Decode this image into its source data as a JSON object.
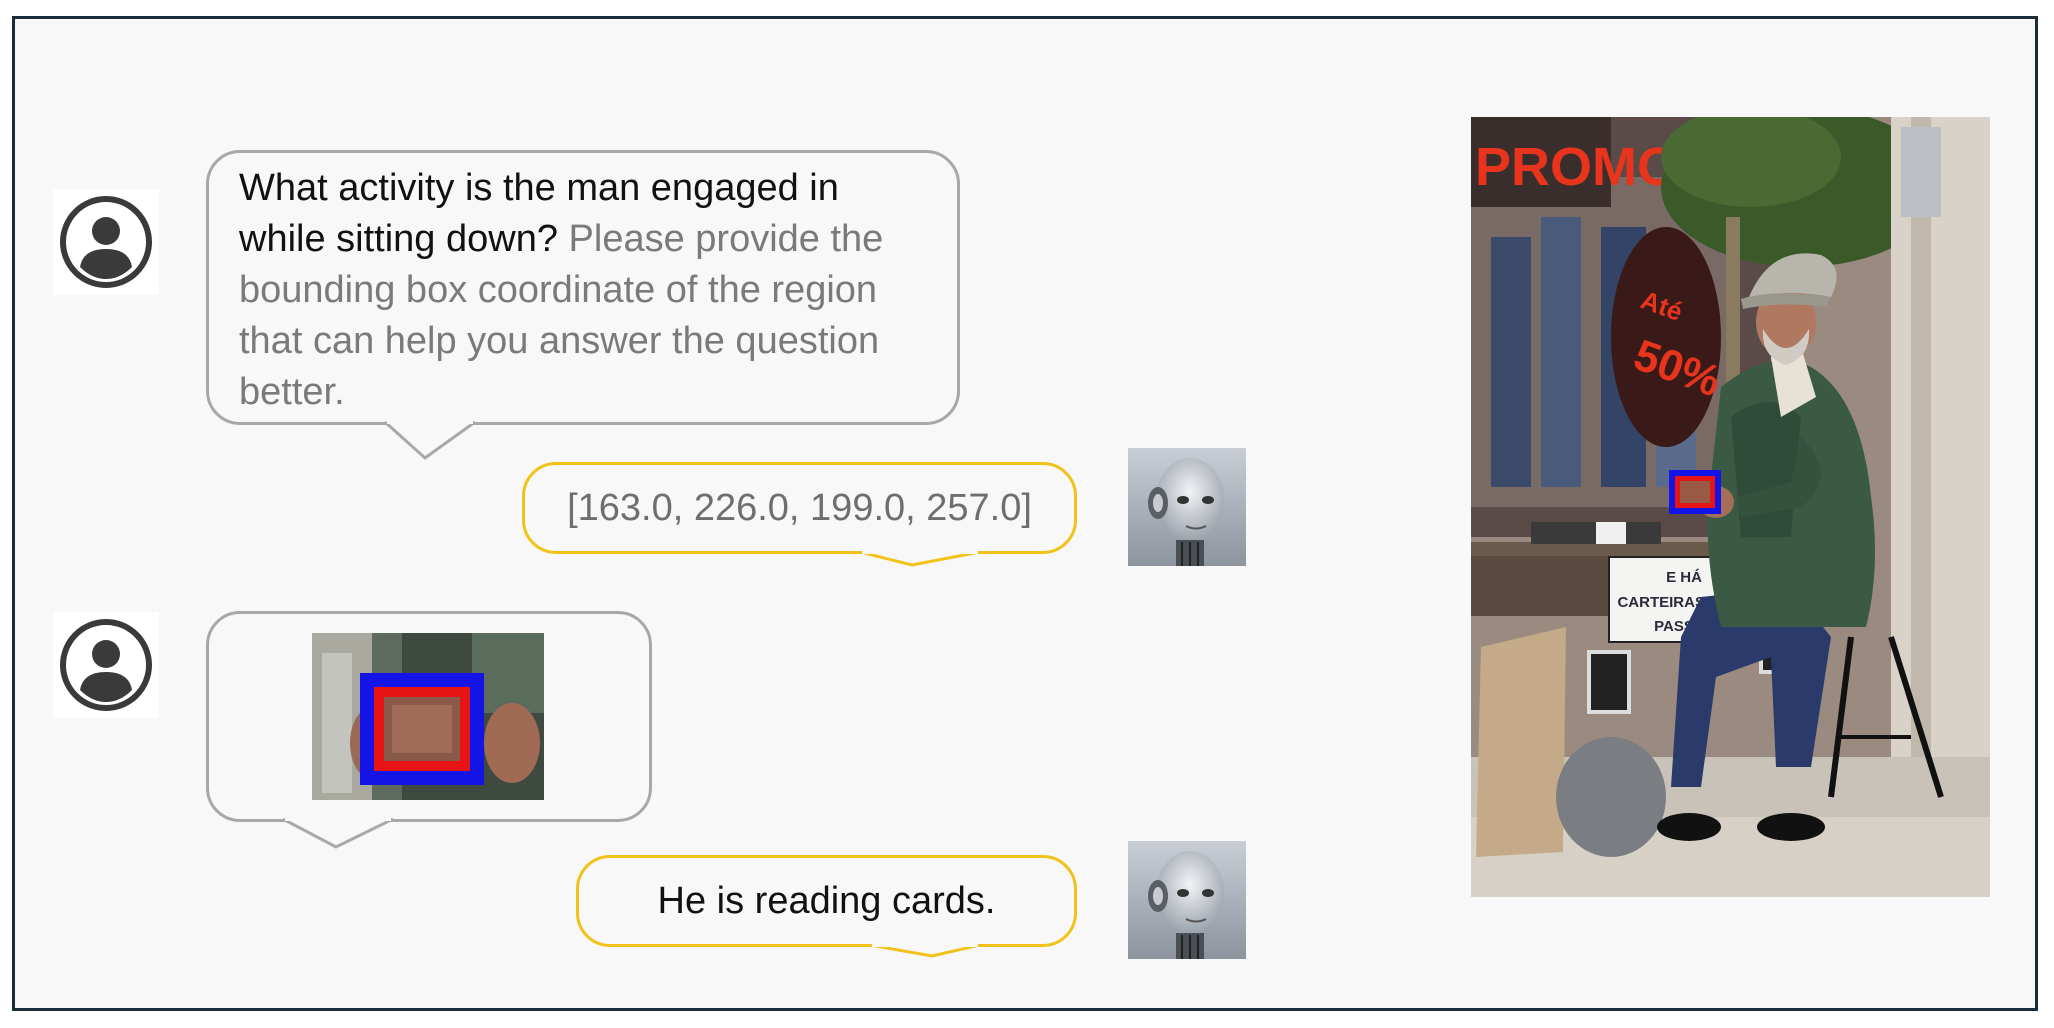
{
  "conversation": {
    "turn1": {
      "question_main": "What activity is the man engaged in while sitting down?",
      "question_hint": "Please provide the bounding box coordinate of the region that can help you answer the question better."
    },
    "turn2": {
      "answer_bbox": "[163.0, 226.0, 199.0, 257.0]"
    },
    "turn3": {
      "image_crop_icon": "cropped-region-image"
    },
    "turn4": {
      "answer_final": "He is reading cards."
    }
  },
  "photo": {
    "sign_promo": "PROMO",
    "sign_ate": "Até",
    "sign_pct": "50%",
    "sign_line1": "E HÁ",
    "sign_line2": "CARTEIRAS PARA",
    "sign_line3": "PASSES"
  },
  "colors": {
    "user_bubble_border": "#a8a8a8",
    "bot_bubble_border": "#f2c21a",
    "bbox_outer": "#1010ee",
    "bbox_inner": "#ee1010",
    "frame_border": "#1a2e38"
  }
}
